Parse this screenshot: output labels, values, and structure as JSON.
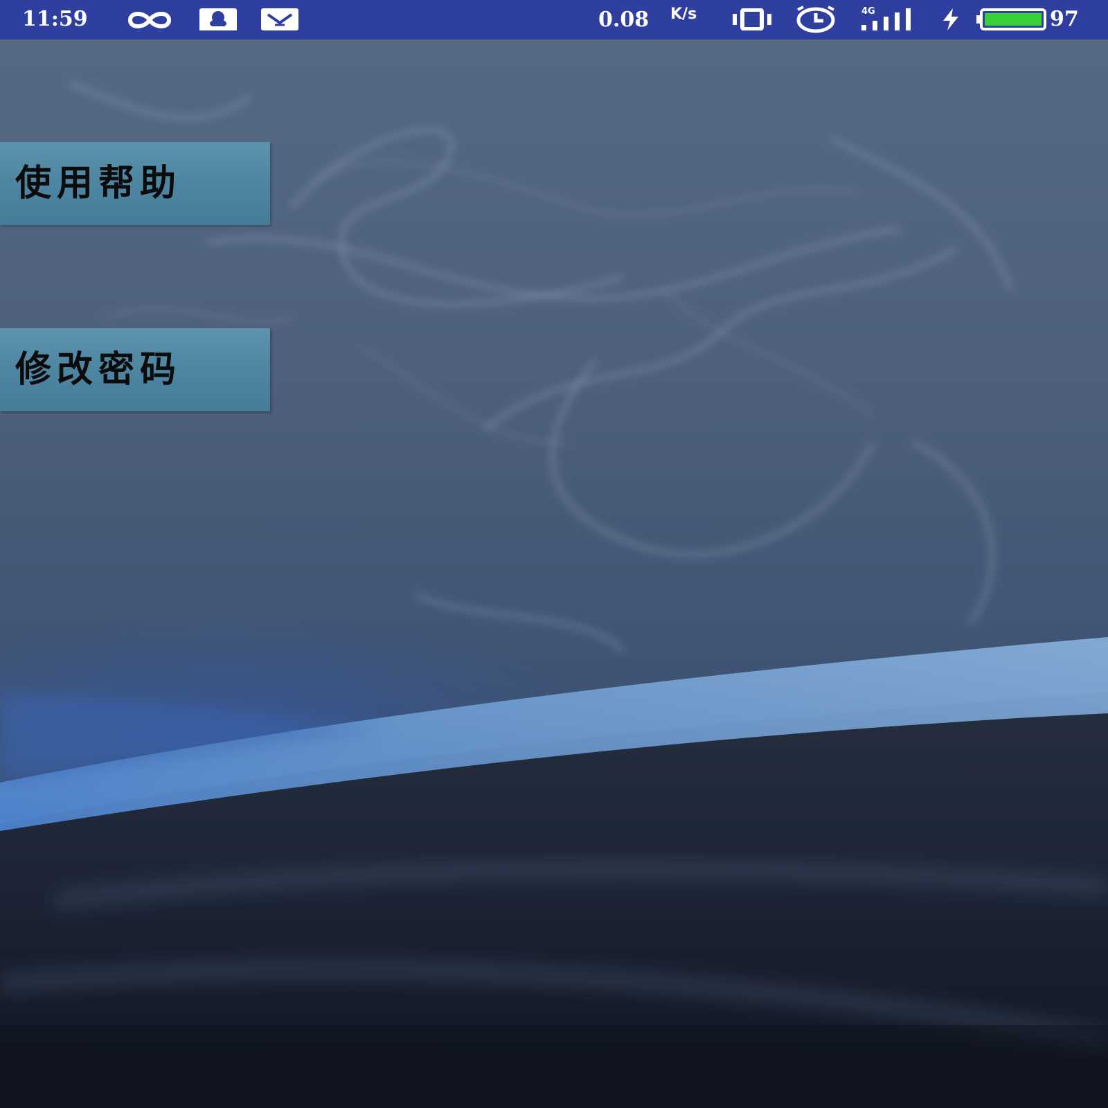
{
  "status_bar": {
    "time": "11:59",
    "net_speed_value": "0.08",
    "net_speed_unit": "K/s",
    "network_type": "4G",
    "battery_level": "97",
    "bg_color": "#2f3fa0",
    "icons": [
      "infinity-icon",
      "qq-icon",
      "mail-icon",
      "vibrate-icon",
      "alarm-icon",
      "signal-4g-icon",
      "charging-icon",
      "battery-icon"
    ]
  },
  "menu": {
    "help_label": "使用帮助",
    "change_password_label": "修改密码",
    "button_color": "#5088a4"
  },
  "wallpaper": {
    "icon": "smoke-wallpaper",
    "base_color": "#4a5a72"
  }
}
